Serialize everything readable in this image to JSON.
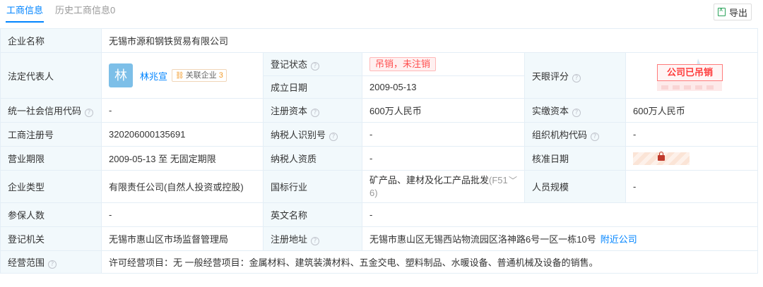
{
  "tabs": [
    {
      "label": "工商信息"
    },
    {
      "label": "历史工商信息0"
    }
  ],
  "export_label": "导出",
  "rows": {
    "company_name": {
      "label": "企业名称",
      "value": "无锡市源和钢铁贸易有限公司"
    },
    "legal_rep": {
      "label": "法定代表人",
      "avatar_char": "林",
      "name": "林兆宣",
      "related_label": "关联企业",
      "related_count": "3"
    },
    "reg_status": {
      "label": "登记状态",
      "value": "吊销，未注销"
    },
    "founded": {
      "label": "成立日期",
      "value": "2009-05-13"
    },
    "tianyan_score": {
      "label": "天眼评分",
      "value": "公司已吊销"
    },
    "credit_code": {
      "label": "统一社会信用代码",
      "value": "-"
    },
    "reg_capital": {
      "label": "注册资本",
      "value": "600万人民币"
    },
    "paid_capital": {
      "label": "实缴资本",
      "value": "600万人民币"
    },
    "reg_number": {
      "label": "工商注册号",
      "value": "320206000135691"
    },
    "taxpayer_id": {
      "label": "纳税人识别号",
      "value": "-"
    },
    "org_code": {
      "label": "组织机构代码",
      "value": "-"
    },
    "business_term": {
      "label": "营业期限",
      "value": "2009-05-13 至 无固定期限"
    },
    "taxpayer_qual": {
      "label": "纳税人资质",
      "value": "-"
    },
    "approval_date": {
      "label": "核准日期"
    },
    "company_type": {
      "label": "企业类型",
      "value": "有限责任公司(自然人投资或控股)"
    },
    "industry": {
      "label": "国标行业",
      "value": "矿产品、建材及化工产品批发",
      "code": "(F51",
      "code2": "6)"
    },
    "staff_size": {
      "label": "人员规模",
      "value": "-"
    },
    "insured": {
      "label": "参保人数",
      "value": "-"
    },
    "english_name": {
      "label": "英文名称",
      "value": "-"
    },
    "reg_authority": {
      "label": "登记机关",
      "value": "无锡市惠山区市场监督管理局"
    },
    "reg_address": {
      "label": "注册地址",
      "value": "无锡市惠山区无锡西站物流园区洛神路6号一区一栋10号",
      "link": "附近公司"
    },
    "scope": {
      "label": "经营范围",
      "value": "许可经营项目：无 一般经营项目：金属材料、建筑装潢材料、五金交电、塑料制品、水暖设备、普通机械及设备的销售。"
    }
  },
  "colors": {
    "accent": "#0084ff",
    "danger": "#ff4e4e",
    "label_bg": "#f2f9fc"
  }
}
